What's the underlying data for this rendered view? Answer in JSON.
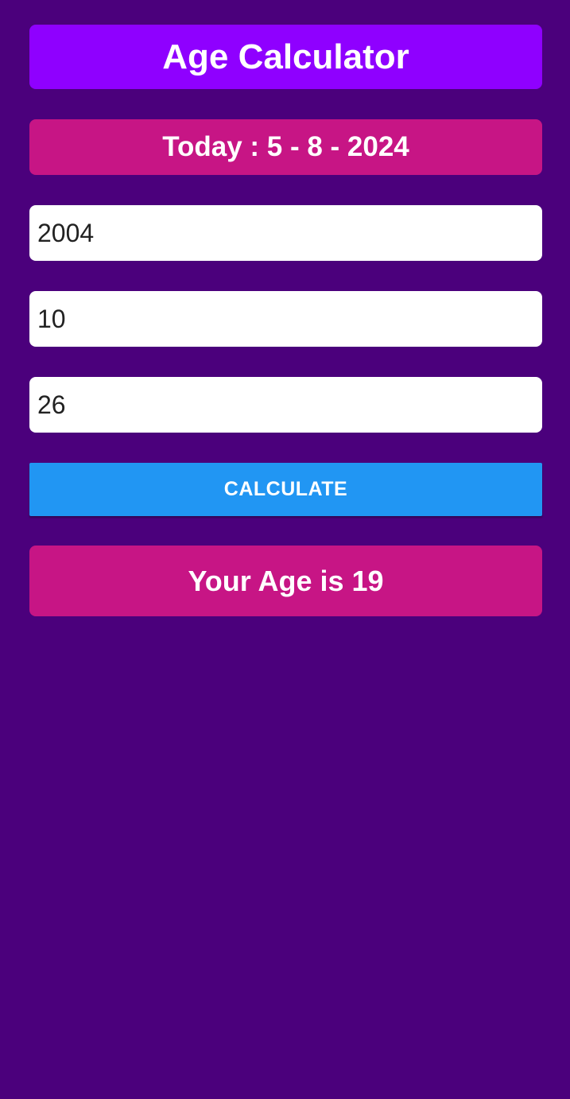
{
  "app": {
    "title": "Age Calculator",
    "today_text": "Today : 5 - 8 - 2024"
  },
  "form": {
    "year_value": "2004",
    "month_value": "10",
    "day_value": "26",
    "calculate_label": "CALCULATE"
  },
  "result": {
    "text": "Your Age is 19"
  },
  "colors": {
    "background": "#4b007c",
    "title_bar": "#8f00ff",
    "today_bar": "#c71585",
    "button": "#2196f3",
    "result_bar": "#c71585"
  }
}
